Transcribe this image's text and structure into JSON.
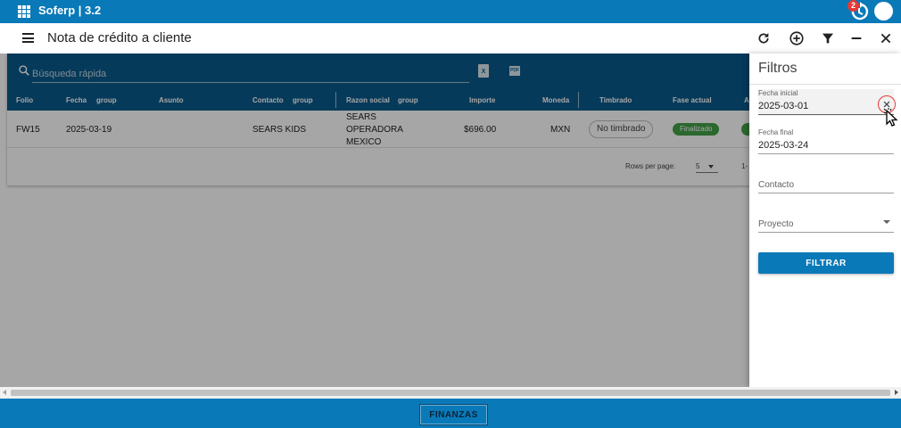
{
  "appbar": {
    "title": "Soferp | 3.2",
    "sync_badge": "2",
    "colors": {
      "primary": "#0a79b8",
      "table_header": "#0a5a8a",
      "success": "#43a047",
      "badge": "#e53935"
    }
  },
  "toolbar": {
    "page_title": "Nota de crédito a cliente",
    "icons": [
      "refresh-icon",
      "add-circle-icon",
      "filter-icon",
      "minimize-icon",
      "close-icon"
    ]
  },
  "search": {
    "placeholder": "Búsqueda rápida",
    "xls_label": "X",
    "pdf_label": "PDF"
  },
  "table": {
    "headers": {
      "folio": "Folio",
      "fecha": "Fecha",
      "fecha_group": "group",
      "asunto": "Asunto",
      "contacto": "Contacto",
      "contacto_group": "group",
      "razon_social": "Razon social",
      "razon_group": "group",
      "importe": "Importe",
      "moneda": "Moneda",
      "timbrado": "Timbrado",
      "fase_actual": "Fase actual",
      "extra": "A"
    },
    "rows": [
      {
        "folio": "FW15",
        "fecha": "2025-03-19",
        "asunto": "",
        "contacto": "SEARS KIDS",
        "razon_social_1": "SEARS",
        "razon_social_2": "OPERADORA",
        "razon_social_3": "MEXICO",
        "importe": "$696.00",
        "moneda": "MXN",
        "timbrado": "No timbrado",
        "fase_actual": "Finalizado"
      }
    ],
    "pager": {
      "rows_per_page_label": "Rows per page:",
      "rows_per_page_value": "5",
      "range": "1-"
    }
  },
  "filters": {
    "title": "Filtros",
    "fecha_inicial": {
      "label": "Fecha inicial",
      "value": "2025-03-01"
    },
    "fecha_final": {
      "label": "Fecha final",
      "value": "2025-03-24"
    },
    "contacto": {
      "placeholder": "Contacto"
    },
    "proyecto": {
      "placeholder": "Proyecto"
    },
    "submit_label": "FILTRAR"
  },
  "bottom": {
    "nav_label": "FINANZAS"
  }
}
